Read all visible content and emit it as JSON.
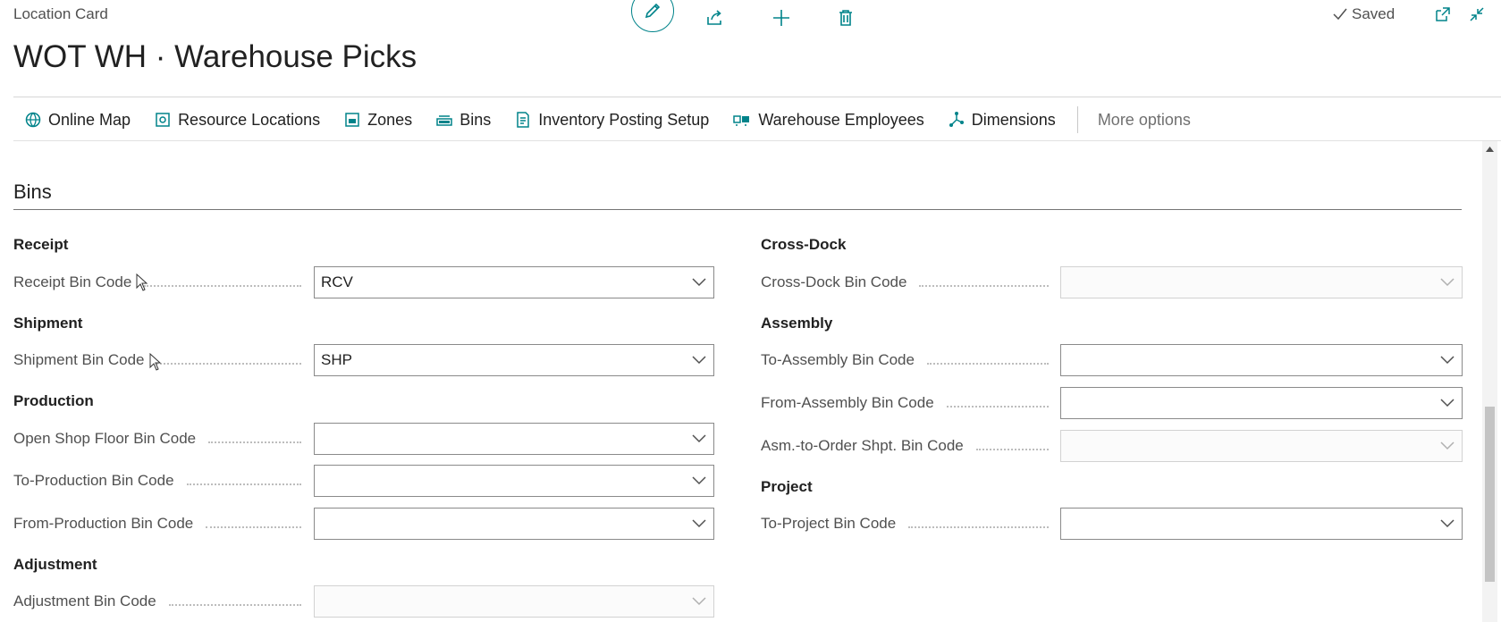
{
  "header": {
    "page_label": "Location Card",
    "title": "WOT WH · Warehouse Picks",
    "saved_label": "Saved"
  },
  "actions": [
    {
      "label": "Online Map",
      "icon": "globe-icon"
    },
    {
      "label": "Resource Locations",
      "icon": "resource-locations-icon"
    },
    {
      "label": "Zones",
      "icon": "zones-icon"
    },
    {
      "label": "Bins",
      "icon": "bins-icon"
    },
    {
      "label": "Inventory Posting Setup",
      "icon": "posting-setup-icon"
    },
    {
      "label": "Warehouse Employees",
      "icon": "employees-icon"
    },
    {
      "label": "Dimensions",
      "icon": "dimensions-icon"
    }
  ],
  "more_options": "More options",
  "section": {
    "title": "Bins"
  },
  "left": {
    "receipt": {
      "heading": "Receipt",
      "receipt_bin": {
        "label": "Receipt Bin Code",
        "value": "RCV"
      }
    },
    "shipment": {
      "heading": "Shipment",
      "shipment_bin": {
        "label": "Shipment Bin Code",
        "value": "SHP"
      }
    },
    "production": {
      "heading": "Production",
      "open_shop_floor": {
        "label": "Open Shop Floor Bin Code",
        "value": ""
      },
      "to_production": {
        "label": "To-Production Bin Code",
        "value": ""
      },
      "from_production": {
        "label": "From-Production Bin Code",
        "value": ""
      }
    },
    "adjustment": {
      "heading": "Adjustment",
      "adjustment_bin": {
        "label": "Adjustment Bin Code",
        "value": ""
      }
    }
  },
  "right": {
    "crossdock": {
      "heading": "Cross-Dock",
      "crossdock_bin": {
        "label": "Cross-Dock Bin Code",
        "value": ""
      }
    },
    "assembly": {
      "heading": "Assembly",
      "to_assembly": {
        "label": "To-Assembly Bin Code",
        "value": ""
      },
      "from_assembly": {
        "label": "From-Assembly Bin Code",
        "value": ""
      },
      "asm_to_order": {
        "label": "Asm.-to-Order Shpt. Bin Code",
        "value": ""
      }
    },
    "project": {
      "heading": "Project",
      "to_project": {
        "label": "To-Project Bin Code",
        "value": ""
      }
    }
  },
  "colors": {
    "accent": "#00838a",
    "text": "#212121",
    "label": "#505050"
  }
}
